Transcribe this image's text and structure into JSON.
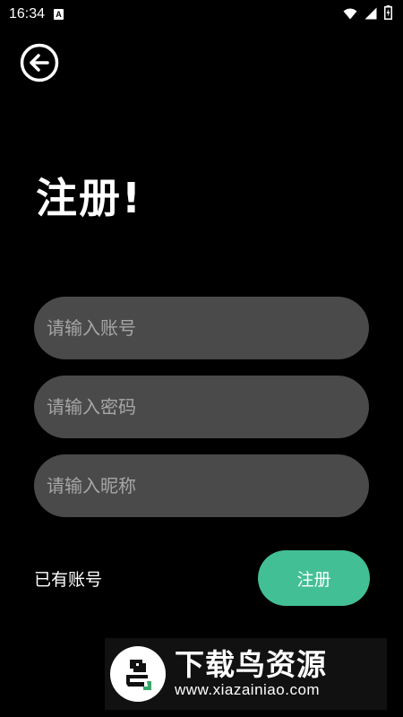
{
  "status_bar": {
    "time": "16:34",
    "notification_badge": "A",
    "icons": [
      "wifi-icon",
      "signal-icon",
      "battery-charging-icon"
    ]
  },
  "header": {
    "back_icon": "back-arrow-circle-icon"
  },
  "page": {
    "title": "注册!"
  },
  "form": {
    "account_placeholder": "请输入账号",
    "password_placeholder": "请输入密码",
    "nickname_placeholder": "请输入昵称",
    "account_value": "",
    "password_value": "",
    "nickname_value": ""
  },
  "actions": {
    "login_link": "已有账号",
    "register_label": "注册"
  },
  "watermark": {
    "title": "下载鸟资源",
    "url": "www.xiazainiao.com"
  },
  "colors": {
    "background": "#000000",
    "input_bg": "#4a4a4a",
    "accent": "#43bf95",
    "placeholder": "#a6a6a6"
  }
}
